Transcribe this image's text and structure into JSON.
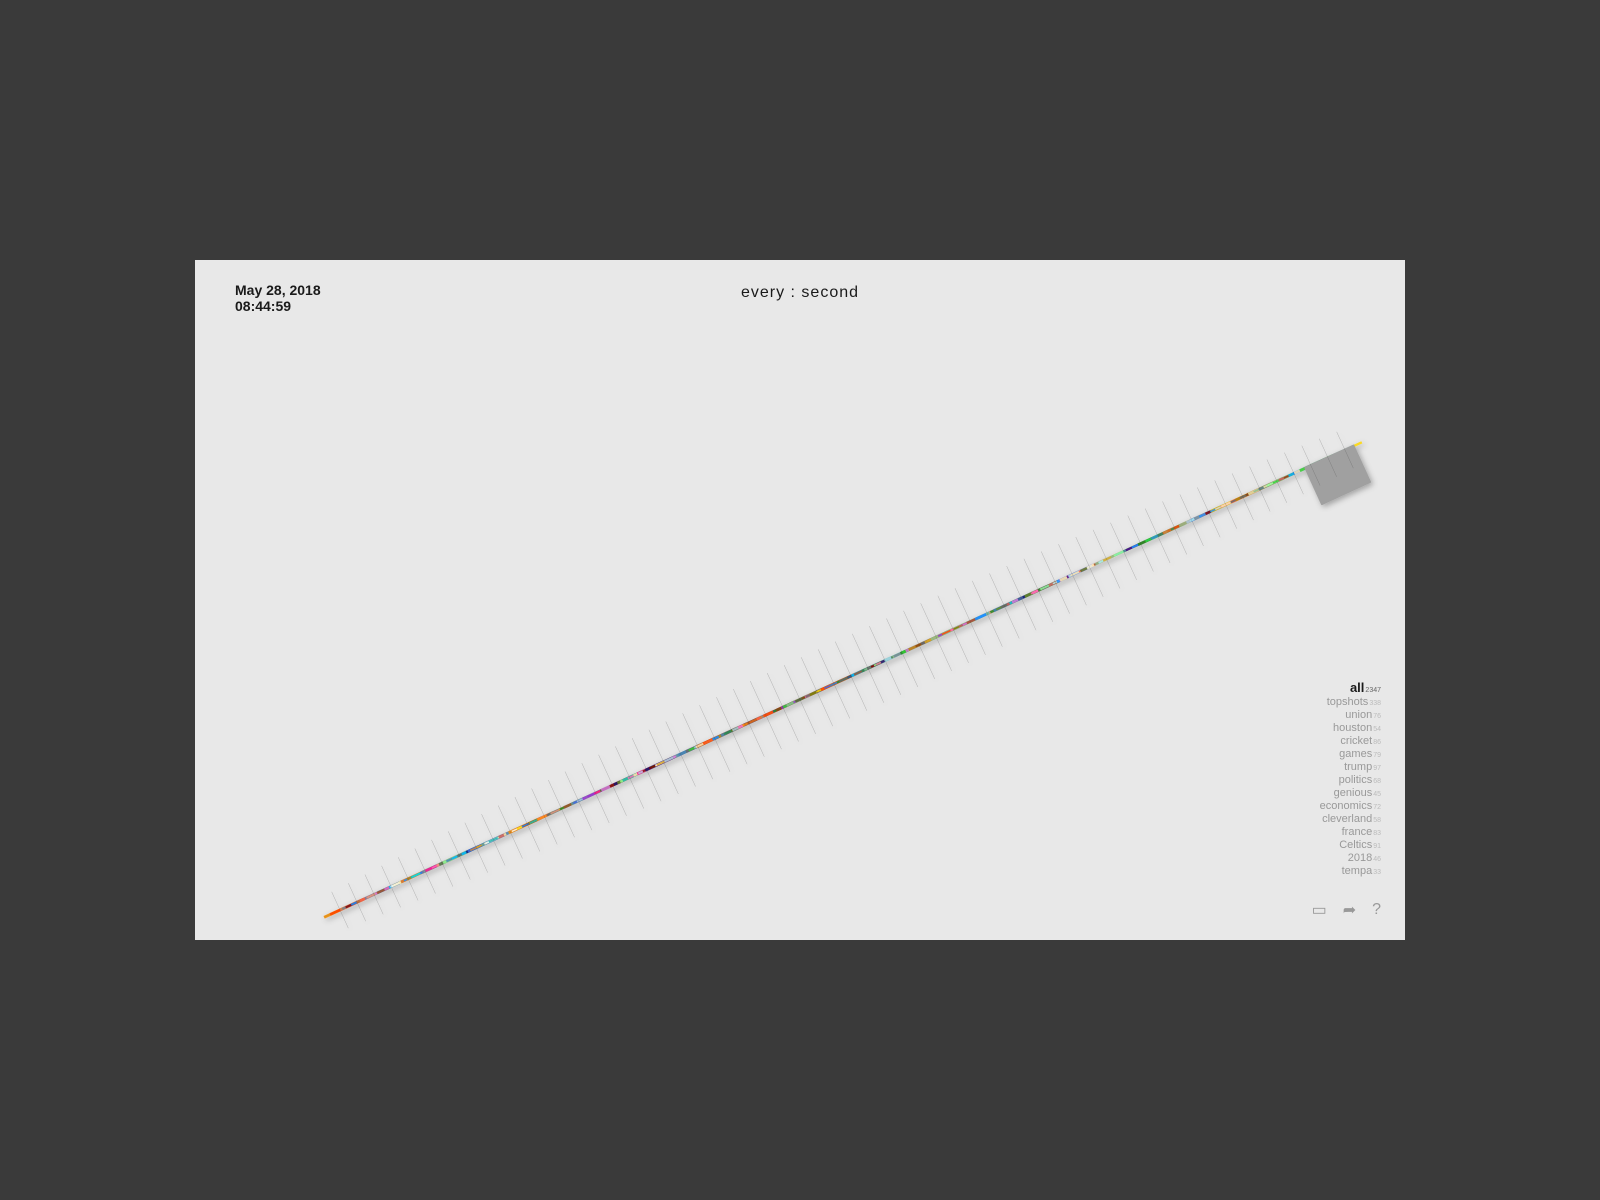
{
  "header": {
    "date": "May 28, 2018",
    "time": "08:44:59",
    "title": "every : second"
  },
  "tags": [
    {
      "name": "all",
      "count": "2347",
      "active": true
    },
    {
      "name": "topshots",
      "count": "338",
      "active": false
    },
    {
      "name": "union",
      "count": "76",
      "active": false
    },
    {
      "name": "houston",
      "count": "54",
      "active": false
    },
    {
      "name": "cricket",
      "count": "86",
      "active": false
    },
    {
      "name": "games",
      "count": "79",
      "active": false
    },
    {
      "name": "trump",
      "count": "97",
      "active": false
    },
    {
      "name": "politics",
      "count": "68",
      "active": false
    },
    {
      "name": "genious",
      "count": "45",
      "active": false
    },
    {
      "name": "economics",
      "count": "72",
      "active": false
    },
    {
      "name": "cleverland",
      "count": "58",
      "active": false
    },
    {
      "name": "france",
      "count": "83",
      "active": false
    },
    {
      "name": "Celtics",
      "count": "91",
      "active": false
    },
    {
      "name": "2018",
      "count": "46",
      "active": false
    },
    {
      "name": "tempa",
      "count": "33",
      "active": false
    }
  ],
  "icons": {
    "bookmark": "⊟",
    "share": "⇧",
    "help": "?"
  }
}
